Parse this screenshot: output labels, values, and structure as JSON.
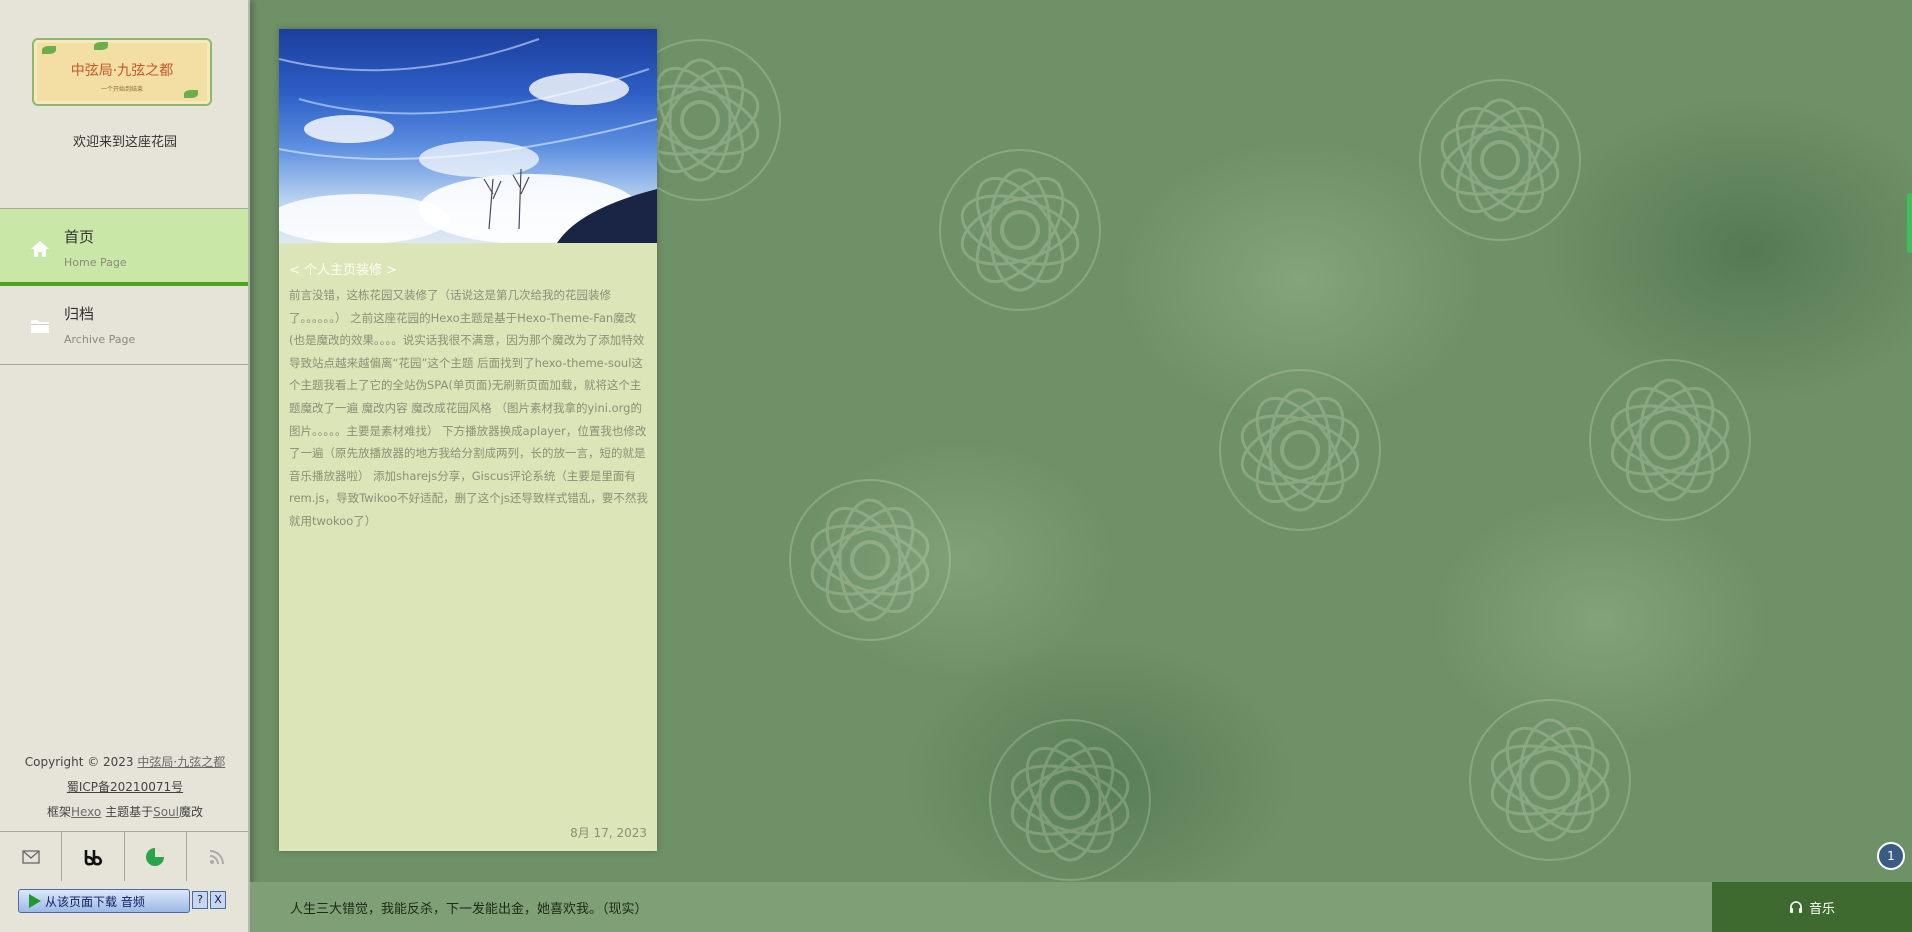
{
  "sidebar": {
    "logo": {
      "title": "中弦局·九弦之都",
      "subtitle": "一个开始到结束"
    },
    "welcome": "欢迎来到这座花园",
    "nav": [
      {
        "title": "首页",
        "subtitle": "Home Page",
        "icon": "home-icon",
        "active": true
      },
      {
        "title": "归档",
        "subtitle": "Archive Page",
        "icon": "folder-icon",
        "active": false
      }
    ],
    "copyright": {
      "prefix": "Copyright © 2023 ",
      "site_link": "中弦局·九弦之都",
      "icp": "蜀ICP备20210071号",
      "framework_prefix": "框架",
      "framework_link": "Hexo",
      "theme_prefix": " 主题基于",
      "theme_link": "Soul",
      "theme_suffix": "魔改"
    },
    "social": [
      "mail-icon",
      "bilibili-icon",
      "stats-icon",
      "rss-icon"
    ]
  },
  "post": {
    "title": "< 个人主页装修 >",
    "excerpt": "前言没错，这栋花园又装修了（话说这是第几次给我的花园装修了。。。。。。） 之前这座花园的Hexo主题是基于Hexo-Theme-Fan魔改(也是魔改的效果。。。。说实话我很不满意，因为那个魔改为了添加特效导致站点越来越偏离“花园”这个主题 后面找到了hexo-theme-soul这个主题我看上了它的全站伪SPA(单页面)无刷新页面加载，就将这个主题魔改了一遍 魔改内容 魔改成花园风格 （图片素材我拿的yini.org的图片。。。。。主要是素材难找） 下方播放器换成aplayer，位置我也修改了一遍（原先放播放器的地方我给分割成两列，长的放一言，短的就是音乐播放器啦） 添加sharejs分享，Giscus评论系统（主要是里面有rem.js，导致Twikoo不好适配，删了这个js还导致样式错乱，要不然我就用twokoo了）",
    "date": "8月 17, 2023"
  },
  "bottom_bar": {
    "quote": "人生三大错觉，我能反杀，下一发能出金，她喜欢我。（现实）",
    "music_label": "音乐"
  },
  "download_bar": {
    "label": "从该页面下载 音频",
    "help": "?",
    "close": "X"
  },
  "badge": "1",
  "colors": {
    "accent": "#4da21e",
    "nav_active_bg": "#c9e7a6",
    "card_bg": "#dce5b8",
    "music_btn": "#3f6a2f"
  }
}
